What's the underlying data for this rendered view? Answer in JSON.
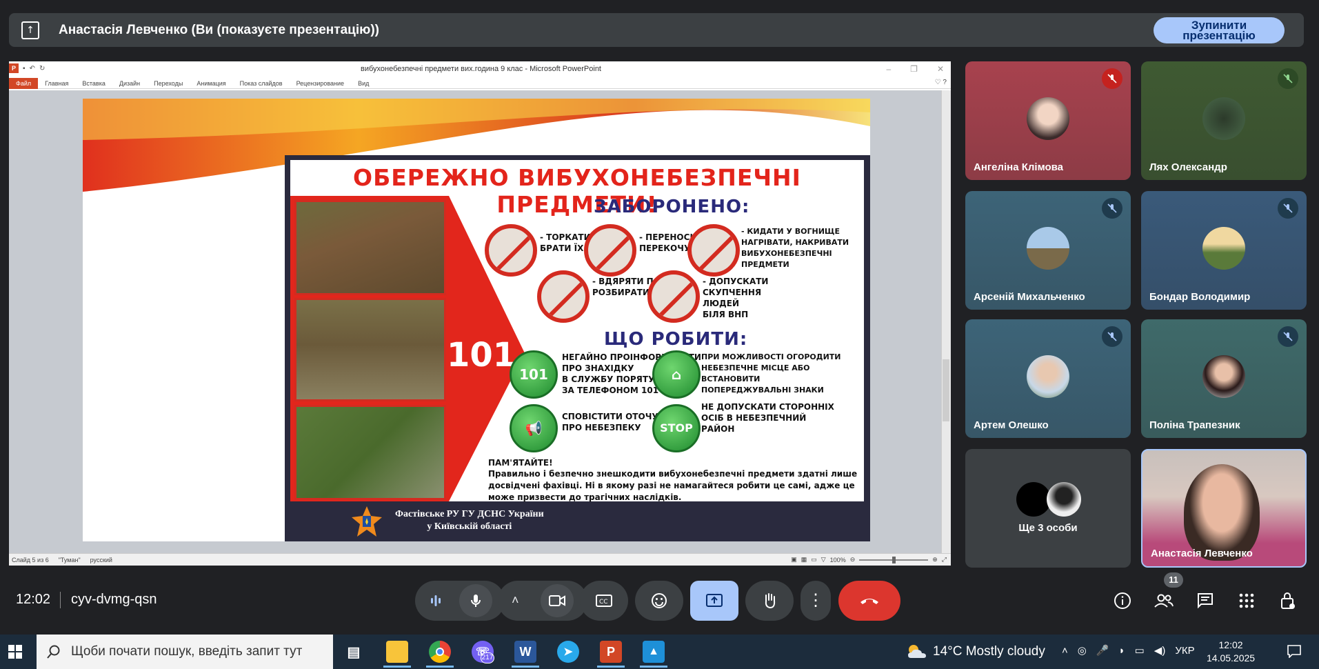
{
  "topbar": {
    "title": "Анастасія Левченко (Ви (показуєте презентацію))",
    "stop_button": "Зупинити презентацію"
  },
  "ppt": {
    "doc_title": "вибухонебезпечні предмети вих.година 9 клас  -  Microsoft PowerPoint",
    "tabs": [
      "Файл",
      "Главная",
      "Вставка",
      "Дизайн",
      "Переходы",
      "Анимация",
      "Показ слайдов",
      "Рецензирование",
      "Вид"
    ],
    "status": {
      "slide": "Слайд 5 из 6",
      "theme": "\"Туман\"",
      "lang": "русский",
      "zoom": "100%"
    }
  },
  "slide": {
    "headline": "ОБЕРЕЖНО ВИБУХОНЕБЕЗПЕЧНІ ПРЕДМЕТИ!",
    "forbidden_title": "ЗАБОРОНЕНО:",
    "number": "101",
    "forbidden": [
      "- ТОРКАТИСЯ,\nБРАТИ ЇХ У РУКИ",
      "- ПЕРЕНОСИТИ АБО\nПЕРЕКОЧУВАТИ ЇХ",
      "- КИДАТИ У ВОГНИЩЕ\nНАГРІВАТИ, НАКРИВАТИ\nВИБУХОНЕБЕЗПЕЧНІ\nПРЕДМЕТИ",
      "- ВДЯРЯТИ ПО НИХ,\nРОЗБИРАТИ ЇХ",
      "- ДОПУСКАТИ\nСКУПЧЕННЯ\nЛЮДЕЙ\nБІЛЯ ВНП"
    ],
    "todo_title": "ЩО РОБИТИ:",
    "todo": [
      "НЕГАЙНО ПРОІНФОРМУВАТИ\nПРО ЗНАХІДКУ\nВ СЛУЖБУ ПОРЯТУНКУ\nЗА ТЕЛЕФОНОМ 101",
      "ПРИ МОЖЛИВОСТІ ОГОРОДИТИ\nНЕБЕЗПЕЧНЕ МІСЦЕ АБО\nВСТАНОВИТИ\nПОПЕРЕДЖУВАЛЬНІ ЗНАКИ",
      "СПОВІСТИТИ ОТОЧУЮЧИХ\nПРО НЕБЕЗПЕКУ",
      "НЕ ДОПУСКАТИ СТОРОННІХ\nОСІБ В НЕБЕЗПЕЧНИЙ\nРАЙОН"
    ],
    "phone_badge": "101",
    "stop_sign": "STOP",
    "remember_title": "ПАМ'ЯТАЙТЕ!",
    "remember_text": "Правильно і безпечно знешкодити вибухонебезпечні предмети здатні лише досвідчені фахівці. Ні в якому разі не намагайтеся робити це самі, адже це може призвести до трагічних наслідків.",
    "footer": "Фастівське РУ ГУ ДСНС України\nу Київській області"
  },
  "participants": [
    {
      "name": "Ангеліна Клімова",
      "bg": "#a8424e",
      "mute_bg": "#c5221f"
    },
    {
      "name": "Лях Олександр",
      "bg": "#3f5a32",
      "mute_bg": "#2d4a26"
    },
    {
      "name": "Арсеній Михальченко",
      "bg": "#3d6478",
      "mute_bg": "#1f3b4d"
    },
    {
      "name": "Бондар Володимир",
      "bg": "#3a5a7a",
      "mute_bg": "#1f3b4d"
    },
    {
      "name": "Артем Олешко",
      "bg": "#3d6478",
      "mute_bg": "#1f3b4d"
    },
    {
      "name": "Поліна Трапезник",
      "bg": "#3f6a6a",
      "mute_bg": "#1f3b4d"
    }
  ],
  "others_tile": {
    "label": "Ще 3 особи"
  },
  "self_tile": {
    "name": "Анастасія Левченко"
  },
  "bottom": {
    "time": "12:02",
    "meeting_code": "cyv-dvmg-qsn",
    "people_count": "11"
  },
  "taskbar": {
    "search_placeholder": "Щоби почати пошук, введіть запит тут",
    "viber_badge": "217",
    "weather": "14°C  Mostly cloudy",
    "lang": "УКР",
    "time": "12:02",
    "date": "14.05.2025"
  }
}
